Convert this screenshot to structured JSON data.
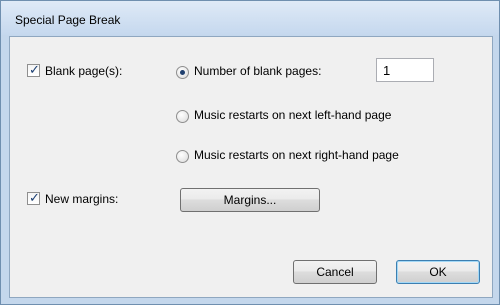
{
  "window": {
    "title": "Special Page Break"
  },
  "blank_pages": {
    "checkbox_label": "Blank page(s):",
    "checked": true,
    "options": [
      {
        "label": "Number of blank pages:",
        "selected": true
      },
      {
        "label": "Music restarts on next left-hand page",
        "selected": false
      },
      {
        "label": "Music restarts on next right-hand page",
        "selected": false
      }
    ],
    "count_value": "1"
  },
  "margins": {
    "checkbox_label": "New margins:",
    "checked": true,
    "button_label": "Margins..."
  },
  "buttons": {
    "cancel": "Cancel",
    "ok": "OK"
  }
}
